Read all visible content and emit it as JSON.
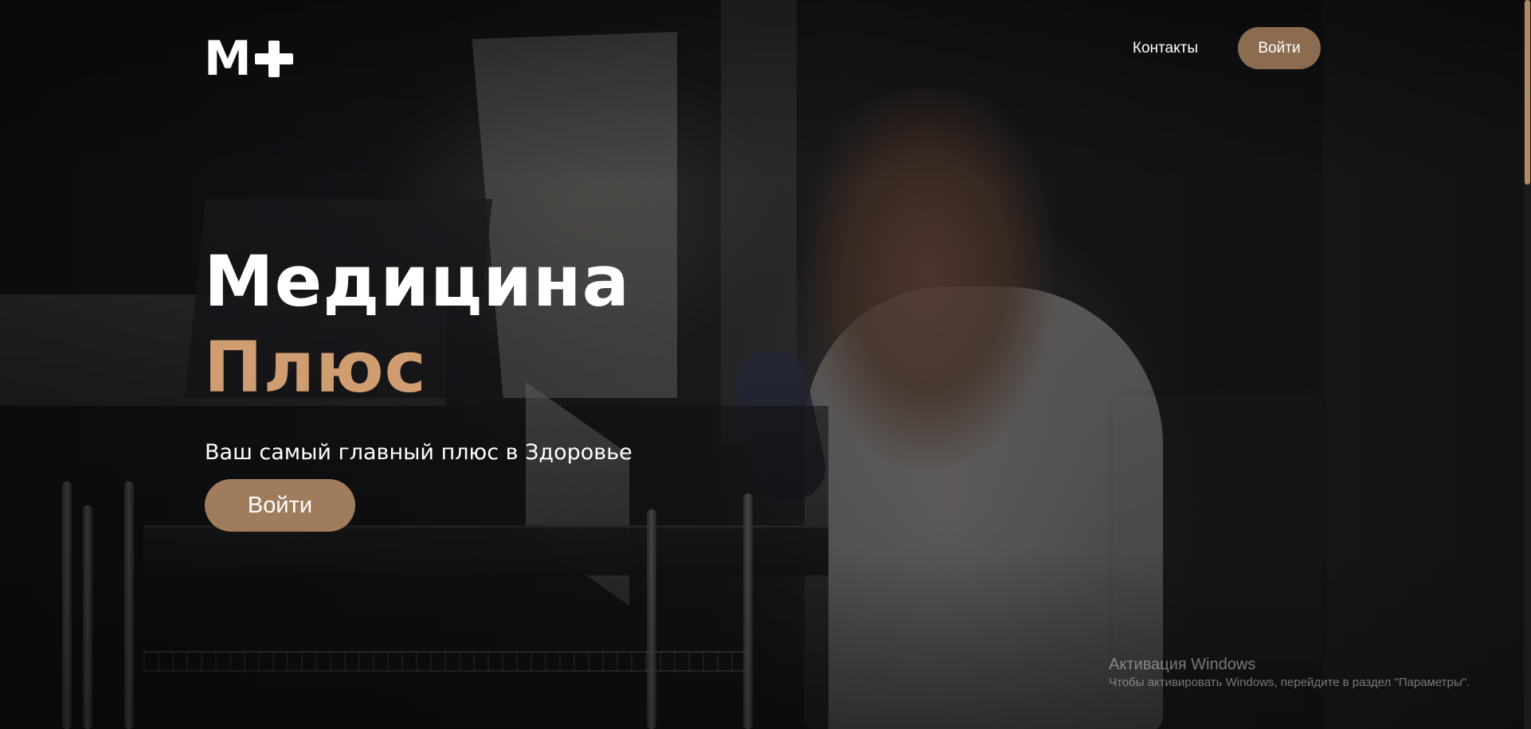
{
  "header": {
    "logo_text": "M",
    "logo_icon": "plus-icon",
    "nav": {
      "contacts_label": "Контакты",
      "login_label": "Войти"
    }
  },
  "hero": {
    "title_line1": "Медицина",
    "title_line2": "Плюс",
    "subtitle": "Ваш самый главный плюс в Здоровье",
    "cta_label": "Войти"
  },
  "watermark": {
    "title": "Активация Windows",
    "text": "Чтобы активировать Windows, перейдите в раздел \"Параметры\"."
  },
  "colors": {
    "accent": "#8c6c50",
    "title_accent": "#d09d70",
    "cta": "#9f7c5c",
    "scrollbar": "#b08968"
  }
}
